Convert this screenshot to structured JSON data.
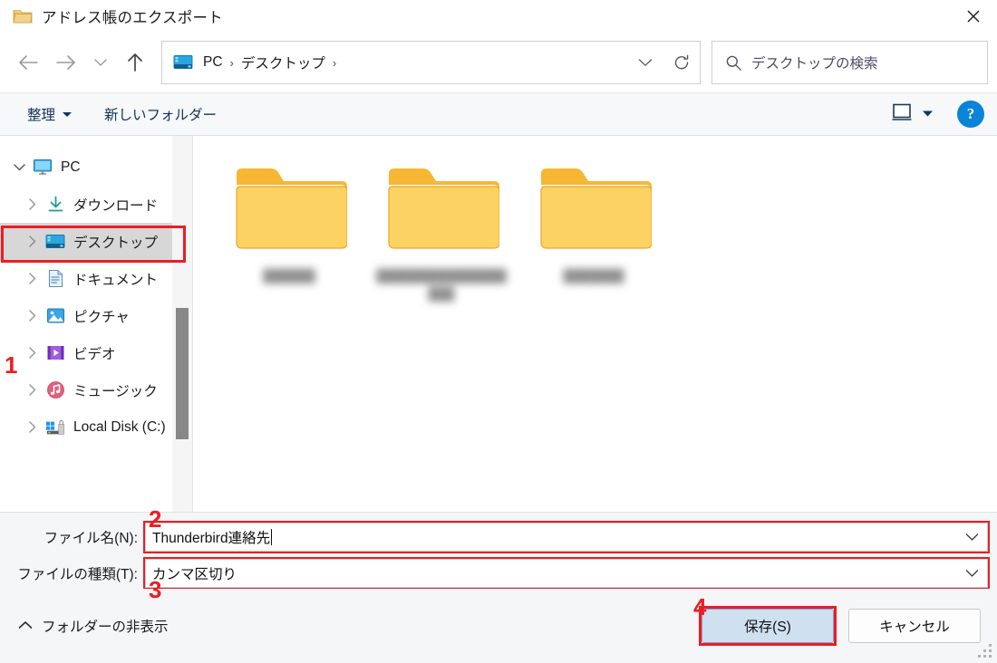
{
  "window": {
    "title": "アドレス帳のエクスポート",
    "title_icon": "folder-icon",
    "close_label": "✕"
  },
  "nav": {
    "back_icon": "back-arrow-icon",
    "forward_icon": "forward-arrow-icon",
    "recent_icon": "chevron-down-icon",
    "up_icon": "up-arrow-icon",
    "breadcrumb": {
      "icon": "desktop-icon",
      "items": [
        "PC",
        "デスクトップ"
      ],
      "trailing_separator": "›"
    },
    "address_dropdown_icon": "chevron-down-icon",
    "refresh_icon": "refresh-icon"
  },
  "search": {
    "icon": "search-icon",
    "placeholder": "デスクトップの検索",
    "value": ""
  },
  "commandbar": {
    "organize_label": "整理",
    "new_folder_label": "新しいフォルダー",
    "view_icon": "view-layout-icon",
    "view_caret_icon": "chevron-down-icon",
    "help_label": "?"
  },
  "tree": {
    "items": [
      {
        "label": "PC",
        "icon": "monitor-icon",
        "level": 0,
        "expander": "chevron-down",
        "selected": false
      },
      {
        "label": "ダウンロード",
        "icon": "download-icon",
        "level": 1,
        "expander": "chevron-right",
        "selected": false
      },
      {
        "label": "デスクトップ",
        "icon": "desktop-icon",
        "level": 1,
        "expander": "chevron-right",
        "selected": true
      },
      {
        "label": "ドキュメント",
        "icon": "document-icon",
        "level": 1,
        "expander": "chevron-right",
        "selected": false
      },
      {
        "label": "ピクチャ",
        "icon": "picture-icon",
        "level": 1,
        "expander": "chevron-right",
        "selected": false
      },
      {
        "label": "ビデオ",
        "icon": "video-icon",
        "level": 1,
        "expander": "chevron-right",
        "selected": false
      },
      {
        "label": "ミュージック",
        "icon": "music-icon",
        "level": 1,
        "expander": "chevron-right",
        "selected": false
      },
      {
        "label": "Local Disk (C:)",
        "icon": "drive-icon",
        "level": 1,
        "expander": "chevron-right",
        "selected": false
      }
    ]
  },
  "files": {
    "items": [
      {
        "icon": "folder-icon",
        "name_redacted": "██████",
        "lines": 1
      },
      {
        "icon": "folder-icon",
        "name_redacted": "██████████████████",
        "lines": 2
      },
      {
        "icon": "folder-icon",
        "name_redacted": "███████",
        "lines": 1
      }
    ]
  },
  "fields": {
    "filename_label": "ファイル名(N):",
    "filename_value": "Thunderbird連絡先",
    "filename_dropdown_icon": "chevron-down-icon",
    "filetype_label": "ファイルの種類(T):",
    "filetype_value": "カンマ区切り",
    "filetype_dropdown_icon": "chevron-down-icon"
  },
  "actions": {
    "hide_folders_label": "フォルダーの非表示",
    "hide_folders_icon": "chevron-up-icon",
    "save_label": "保存(S)",
    "cancel_label": "キャンセル"
  },
  "annotations": {
    "accent_color": "#ee1c24",
    "markers": [
      {
        "number": "1",
        "target": "sidebar-item-desktop"
      },
      {
        "number": "2",
        "target": "filename-input"
      },
      {
        "number": "3",
        "target": "filetype-input"
      },
      {
        "number": "4",
        "target": "save-button"
      }
    ]
  }
}
